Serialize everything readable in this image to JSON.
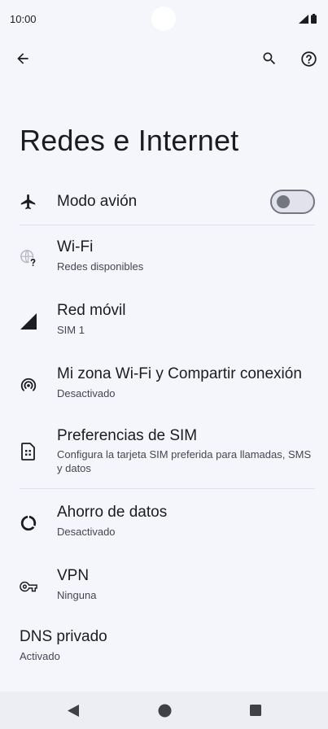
{
  "status_bar": {
    "time": "10:00",
    "icons": [
      "signal-icon",
      "battery-icon"
    ]
  },
  "app_bar": {
    "icons": [
      "back-arrow-icon",
      "search-icon",
      "help-icon"
    ]
  },
  "page": {
    "title": "Redes e Internet"
  },
  "settings": {
    "airplane": {
      "title": "Modo avión",
      "icon": "airplane-icon",
      "toggle_on": false
    },
    "wifi": {
      "title": "Wi-Fi",
      "subtitle": "Redes disponibles",
      "icon": "wifi-question-icon"
    },
    "mobile": {
      "title": "Red móvil",
      "subtitle": "SIM 1",
      "icon": "cell-signal-icon"
    },
    "hotspot": {
      "title": "Mi zona Wi-Fi y Compartir conexión",
      "subtitle": "Desactivado",
      "icon": "hotspot-icon"
    },
    "sim": {
      "title": "Preferencias de SIM",
      "subtitle": "Configura la tarjeta SIM preferida para llamadas, SMS y datos",
      "icon": "sim-card-icon"
    },
    "data_saver": {
      "title": "Ahorro de datos",
      "subtitle": "Desactivado",
      "icon": "data-saver-icon"
    },
    "vpn": {
      "title": "VPN",
      "subtitle": "Ninguna",
      "icon": "vpn-key-icon"
    },
    "dns": {
      "title": "DNS privado",
      "subtitle": "Activado"
    }
  },
  "nav_bar": {
    "icons": [
      "back-triangle-icon",
      "home-circle-icon",
      "recents-square-icon"
    ]
  },
  "colors": {
    "background": "#f4f6fb",
    "text_primary": "#1b1c20",
    "text_secondary": "#44474e",
    "toggle_outline": "#74777f",
    "nav_bar": "#eceef4"
  }
}
